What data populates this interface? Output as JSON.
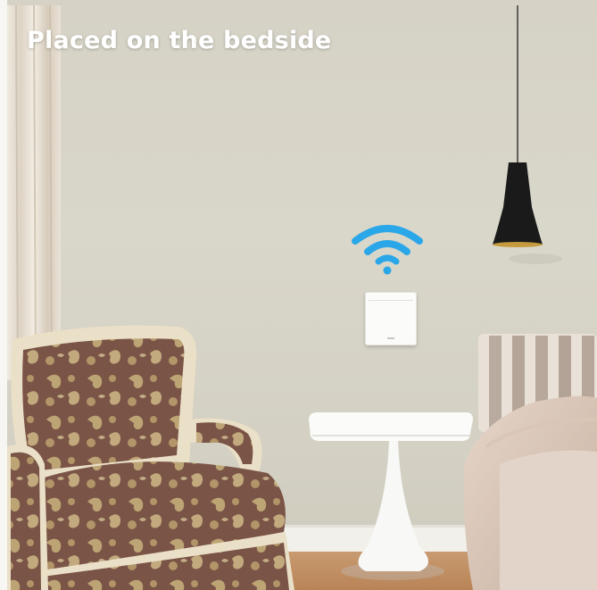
{
  "caption": "Placed on the bedside",
  "icons": {
    "wifi": "wifi-icon",
    "switch": "wall-switch"
  },
  "colors": {
    "wifi_blue": "#2aa7e8",
    "caption_text": "#ffffff",
    "wall": "#d8d5c9"
  }
}
